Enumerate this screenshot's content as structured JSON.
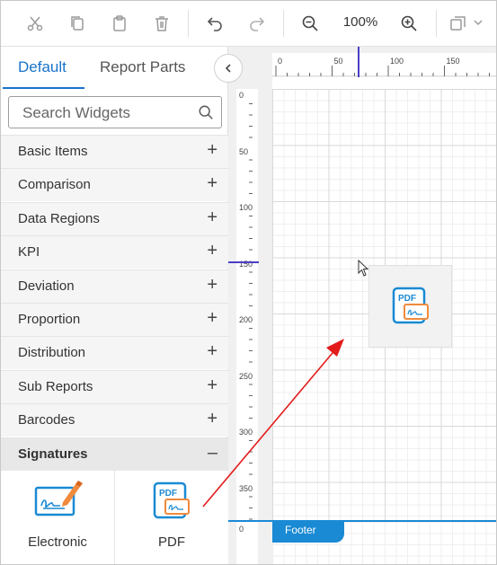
{
  "toolbar": {
    "zoom": "100%",
    "icons": [
      "scissors-icon",
      "copy-icon",
      "paste-icon",
      "delete-icon",
      "undo-icon",
      "redo-icon",
      "zoom-out-icon",
      "zoom-in-icon",
      "layout-icon"
    ]
  },
  "tabs": {
    "default": "Default",
    "report_parts": "Report Parts"
  },
  "search": {
    "placeholder": "Search Widgets"
  },
  "categories": [
    {
      "label": "Basic Items",
      "sign": "+"
    },
    {
      "label": "Comparison",
      "sign": "+"
    },
    {
      "label": "Data Regions",
      "sign": "+"
    },
    {
      "label": "KPI",
      "sign": "+"
    },
    {
      "label": "Deviation",
      "sign": "+"
    },
    {
      "label": "Proportion",
      "sign": "+"
    },
    {
      "label": "Distribution",
      "sign": "+"
    },
    {
      "label": "Sub Reports",
      "sign": "+"
    },
    {
      "label": "Barcodes",
      "sign": "+"
    },
    {
      "label": "Signatures",
      "sign": "–"
    }
  ],
  "widgets": [
    {
      "label": "Electronic"
    },
    {
      "label": "PDF"
    }
  ],
  "ruler": {
    "top_ticks": [
      "0",
      "50",
      "100",
      "150"
    ],
    "left_ticks": [
      "0",
      "50",
      "100",
      "150",
      "200",
      "250",
      "300",
      "350"
    ],
    "footer_tick": "0"
  },
  "footer": {
    "label": "Footer"
  },
  "colors": {
    "accent": "#1a73c8",
    "footer": "#1a8ad4",
    "marker": "#4a3fc7",
    "arrow": "#e31b1b"
  }
}
